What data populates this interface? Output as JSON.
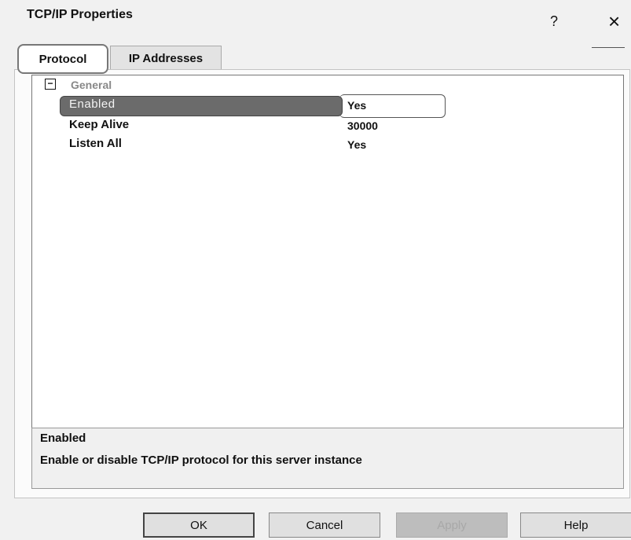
{
  "window": {
    "title": "TCP/IP Properties",
    "help_glyph": "?",
    "close_glyph": "×"
  },
  "tabs": [
    {
      "label": "Protocol",
      "active": true
    },
    {
      "label": "IP Addresses",
      "active": false
    }
  ],
  "grid": {
    "collapse_glyph": "⊟",
    "category": "General",
    "rows": [
      {
        "name": "Enabled",
        "value": "Yes",
        "selected": true
      },
      {
        "name": "Keep Alive",
        "value": "30000",
        "selected": false
      },
      {
        "name": "Listen All",
        "value": "Yes",
        "selected": false
      }
    ]
  },
  "description": {
    "title": "Enabled",
    "text": "Enable or disable TCP/IP protocol for this server instance"
  },
  "buttons": {
    "ok": "OK",
    "cancel": "Cancel",
    "apply": "Apply",
    "help": "Help"
  },
  "colors": {
    "selection": "#6b6b6b",
    "window_bg": "#f1f1f1",
    "disabled_text": "#a8a8a8"
  }
}
